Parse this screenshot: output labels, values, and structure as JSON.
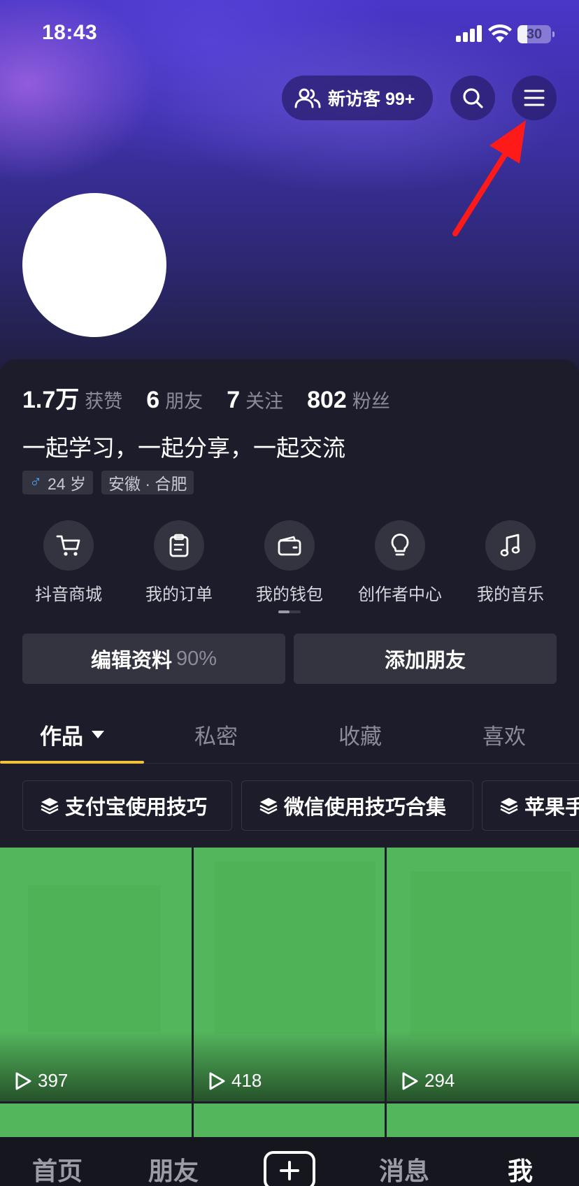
{
  "status_bar": {
    "time": "18:43",
    "battery": "30",
    "battery_level": 0.3
  },
  "header": {
    "visitor_label": "新访客 99+"
  },
  "profile": {
    "stats": [
      {
        "num": "1.7万",
        "label": "获赞"
      },
      {
        "num": "6",
        "label": "朋友"
      },
      {
        "num": "7",
        "label": "关注"
      },
      {
        "num": "802",
        "label": "粉丝"
      }
    ],
    "bio": "一起学习，一起分享，一起交流",
    "age_tag": "24 岁",
    "gender_symbol": "♂",
    "location_tag": "安徽 · 合肥"
  },
  "shortcuts": [
    {
      "label": "抖音商城",
      "icon": "cart-icon"
    },
    {
      "label": "我的订单",
      "icon": "order-icon"
    },
    {
      "label": "我的钱包",
      "icon": "wallet-icon"
    },
    {
      "label": "创作者中心",
      "icon": "bulb-icon"
    },
    {
      "label": "我的音乐",
      "icon": "music-icon"
    }
  ],
  "actions": {
    "edit_profile": "编辑资料",
    "edit_percent": "90%",
    "add_friend": "添加朋友"
  },
  "tabs": [
    "作品",
    "私密",
    "收藏",
    "喜欢"
  ],
  "collections": [
    "支付宝使用技巧",
    "微信使用技巧合集",
    "苹果手"
  ],
  "videos": [
    {
      "plays": "397"
    },
    {
      "plays": "418"
    },
    {
      "plays": "294"
    }
  ],
  "bottom_nav": {
    "home": "首页",
    "friends": "朋友",
    "messages": "消息",
    "me": "我"
  },
  "colors": {
    "accent_underline": "#f0c23a",
    "male_icon": "#4aa4ff",
    "arrow": "#ff1a1a",
    "thumbnail": "#53b55c"
  }
}
